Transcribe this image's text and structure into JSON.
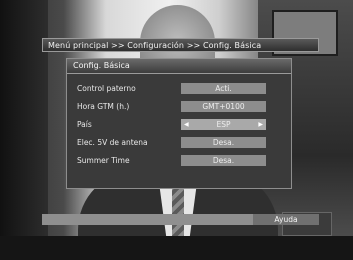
{
  "breadcrumb": "Menú principal >> Configuración >> Config. Básica",
  "dialog": {
    "title": "Config. Básica",
    "rows": [
      {
        "label": "Control paterno",
        "value": "Acti."
      },
      {
        "label": "Hora GTM (h.)",
        "value": "GMT+0100"
      },
      {
        "label": "País",
        "value": "ESP",
        "selected": true
      },
      {
        "label": "Elec. 5V de antena",
        "value": "Desa."
      },
      {
        "label": "Summer Time",
        "value": "Desa."
      }
    ]
  },
  "help": {
    "label": "Ayuda"
  }
}
